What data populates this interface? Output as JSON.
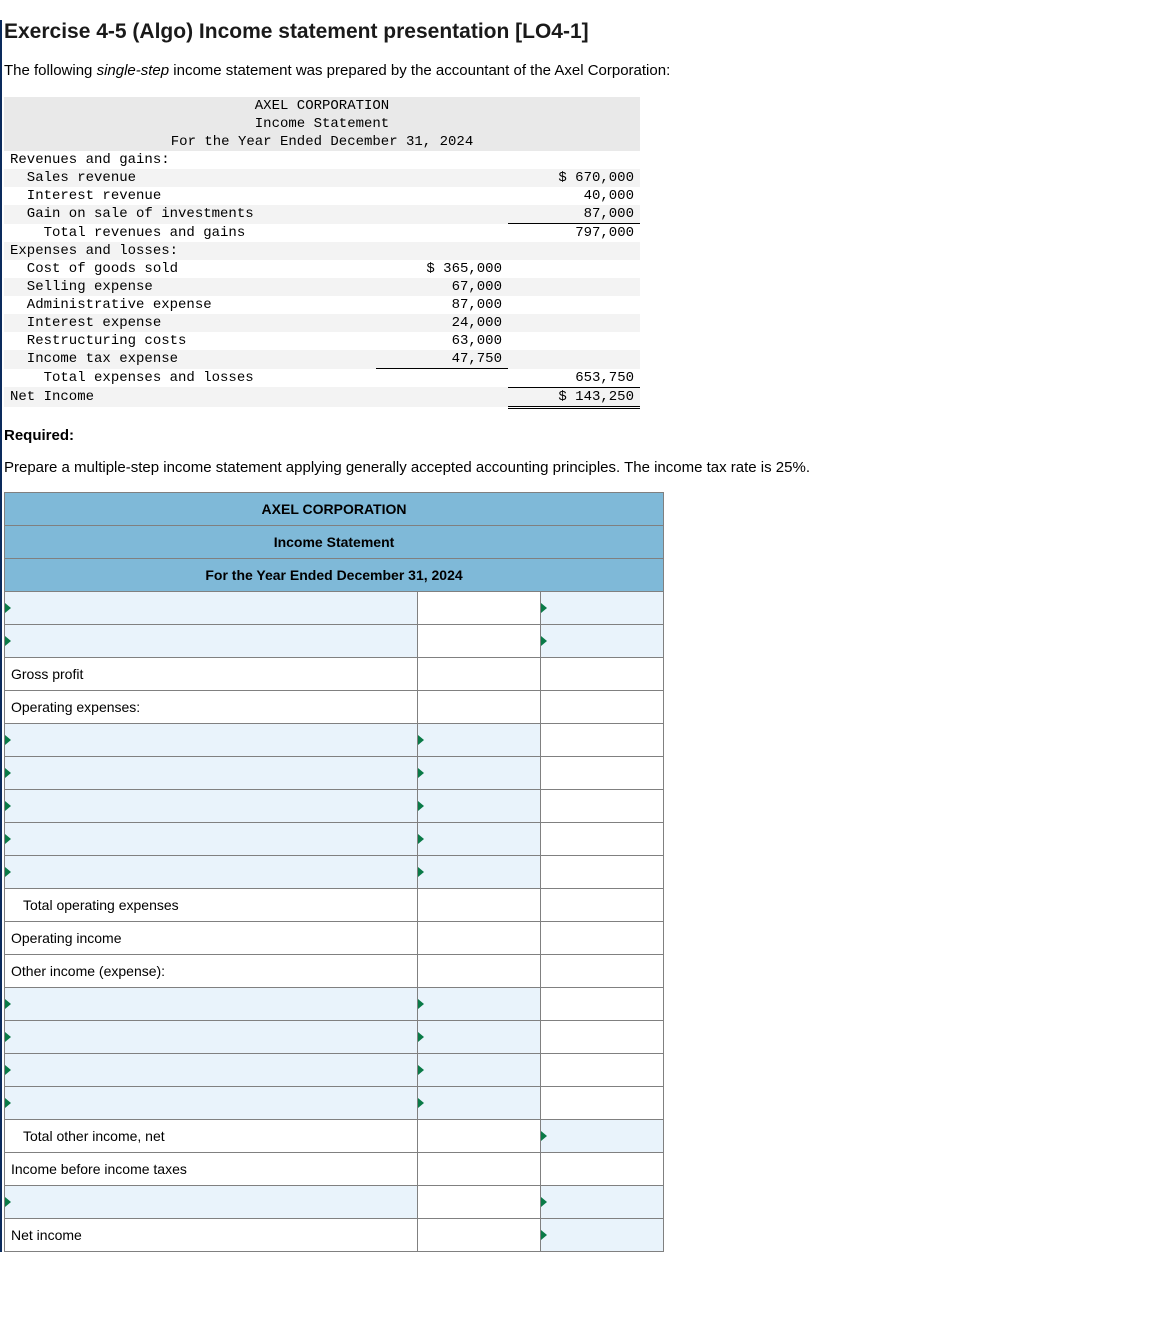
{
  "title": "Exercise 4-5 (Algo) Income statement presentation [LO4-1]",
  "lead_pre": "The following ",
  "lead_em": "single-step",
  "lead_post": " income statement was prepared by the accountant of the Axel Corporation:",
  "ss": {
    "company": "AXEL CORPORATION",
    "stmt": "Income Statement",
    "period": "For the Year Ended December 31, 2024",
    "rev_hdr": "Revenues and gains:",
    "sales_lbl": "  Sales revenue",
    "sales_amt": "$ 670,000",
    "intrev_lbl": "  Interest revenue",
    "intrev_amt": "40,000",
    "gain_lbl": "  Gain on sale of investments",
    "gain_amt": "87,000",
    "totrev_lbl": "    Total revenues and gains",
    "totrev_amt": "797,000",
    "exp_hdr": "Expenses and losses:",
    "cogs_lbl": "  Cost of goods sold",
    "cogs_amt": "$ 365,000",
    "sell_lbl": "  Selling expense",
    "sell_amt": "67,000",
    "admin_lbl": "  Administrative expense",
    "admin_amt": "87,000",
    "intexp_lbl": "  Interest expense",
    "intexp_amt": "24,000",
    "restr_lbl": "  Restructuring costs",
    "restr_amt": "63,000",
    "tax_lbl": "  Income tax expense",
    "tax_amt": "47,750",
    "totexp_lbl": "    Total expenses and losses",
    "totexp_amt": "653,750",
    "ni_lbl": "Net Income",
    "ni_amt": "$ 143,250"
  },
  "required_hdr": "Required:",
  "required_text": "Prepare a multiple-step income statement applying generally accepted accounting principles. The income tax rate is 25%.",
  "ans": {
    "company": "AXEL CORPORATION",
    "stmt": "Income Statement",
    "period": "For the Year Ended December 31, 2024",
    "gross_profit": "Gross profit",
    "opex_hdr": "Operating expenses:",
    "tot_opex": "Total operating expenses",
    "op_income": "Operating income",
    "other_hdr": "Other income (expense):",
    "tot_other": "Total other income, net",
    "pretax": "Income before income taxes",
    "net_income": "Net income"
  }
}
